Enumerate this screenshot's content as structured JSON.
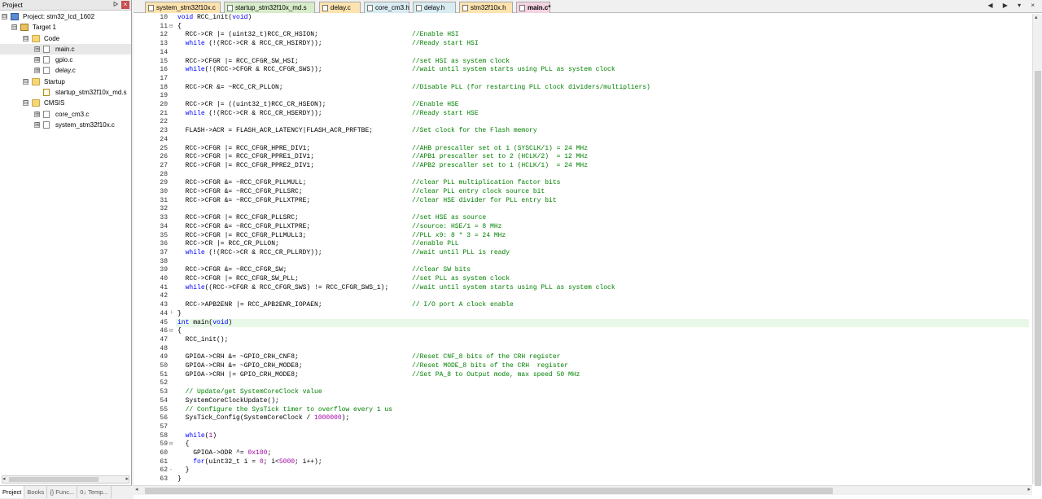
{
  "project_panel": {
    "title": "Project",
    "pin_label": "ᐅ",
    "close_label": "×",
    "tree": [
      {
        "label": "Project: stm32_lcd_1602",
        "icon": "project-icon",
        "expander": "⊟"
      },
      {
        "label": "Target 1",
        "icon": "target-icon",
        "expander": "⊟"
      },
      {
        "label": "Code",
        "icon": "folder-icon",
        "expander": "⊟"
      },
      {
        "label": "main.c",
        "icon": "c-file-icon",
        "expander": "⊞"
      },
      {
        "label": "gpio.c",
        "icon": "c-file-icon",
        "expander": "⊞"
      },
      {
        "label": "delay.c",
        "icon": "c-file-icon",
        "expander": "⊞"
      },
      {
        "label": "Startup",
        "icon": "folder-icon",
        "expander": "⊟"
      },
      {
        "label": "startup_stm32f10x_md.s",
        "icon": "asm-file-icon",
        "expander": ""
      },
      {
        "label": "CMSIS",
        "icon": "folder-icon",
        "expander": "⊟"
      },
      {
        "label": "core_cm3.c",
        "icon": "c-file-icon",
        "expander": "⊞"
      },
      {
        "label": "system_stm32f10x.c",
        "icon": "c-file-icon",
        "expander": "⊞"
      }
    ],
    "bottom_tabs": [
      "Project",
      "Books",
      "{} Func...",
      "0↓ Temp..."
    ]
  },
  "editor": {
    "tabs": [
      {
        "label": "system_stm32f10x.c",
        "kind": "c"
      },
      {
        "label": "startup_stm32f10x_md.s",
        "kind": "s"
      },
      {
        "label": "delay.c",
        "kind": "c"
      },
      {
        "label": "core_cm3.h",
        "kind": "h"
      },
      {
        "label": "delay.h",
        "kind": "h"
      },
      {
        "label": "stm32f10x.h",
        "kind": "c"
      },
      {
        "label": "main.c*",
        "kind": "active"
      }
    ],
    "tab_controls": "◀ ▶ ▾ ×",
    "current_line": 45,
    "lines": [
      {
        "n": 10,
        "fold": "",
        "code": "void RCC_init(void)",
        "comment": ""
      },
      {
        "n": 11,
        "fold": "⊟",
        "code": "{",
        "comment": ""
      },
      {
        "n": 12,
        "fold": "",
        "code": "  RCC->CR |= (uint32_t)RCC_CR_HSION;",
        "comment": "//Enable HSI"
      },
      {
        "n": 13,
        "fold": "",
        "code": "  while (!(RCC->CR & RCC_CR_HSIRDY));",
        "comment": "//Ready start HSI"
      },
      {
        "n": 14,
        "fold": "",
        "code": "",
        "comment": ""
      },
      {
        "n": 15,
        "fold": "",
        "code": "  RCC->CFGR |= RCC_CFGR_SW_HSI;",
        "comment": "//set HSI as system clock"
      },
      {
        "n": 16,
        "fold": "",
        "code": "  while(!(RCC->CFGR & RCC_CFGR_SWS));",
        "comment": "//wait until system starts using PLL as system clock"
      },
      {
        "n": 17,
        "fold": "",
        "code": "",
        "comment": ""
      },
      {
        "n": 18,
        "fold": "",
        "code": "  RCC->CR &= ~RCC_CR_PLLON;",
        "comment": "//Disable PLL (for restarting PLL clock dividers/multipliers)"
      },
      {
        "n": 19,
        "fold": "",
        "code": "",
        "comment": ""
      },
      {
        "n": 20,
        "fold": "",
        "code": "  RCC->CR |= ((uint32_t)RCC_CR_HSEON);",
        "comment": "//Enable HSE"
      },
      {
        "n": 21,
        "fold": "",
        "code": "  while (!(RCC->CR & RCC_CR_HSERDY));",
        "comment": "//Ready start HSE"
      },
      {
        "n": 22,
        "fold": "",
        "code": "",
        "comment": ""
      },
      {
        "n": 23,
        "fold": "",
        "code": "  FLASH->ACR = FLASH_ACR_LATENCY|FLASH_ACR_PRFTBE;",
        "comment": "//Set clock for the Flash memory"
      },
      {
        "n": 24,
        "fold": "",
        "code": "",
        "comment": ""
      },
      {
        "n": 25,
        "fold": "",
        "code": "  RCC->CFGR |= RCC_CFGR_HPRE_DIV1;",
        "comment": "//AHB prescaller set ot 1 (SYSCLK/1) = 24 MHz"
      },
      {
        "n": 26,
        "fold": "",
        "code": "  RCC->CFGR |= RCC_CFGR_PPRE1_DIV1;",
        "comment": "//APB1 prescaller set to 2 (HCLK/2)  = 12 MHz"
      },
      {
        "n": 27,
        "fold": "",
        "code": "  RCC->CFGR |= RCC_CFGR_PPRE2_DIV1;",
        "comment": "//APB2 prescaller set to 1 (HCLK/1)  = 24 MHz"
      },
      {
        "n": 28,
        "fold": "",
        "code": "",
        "comment": ""
      },
      {
        "n": 29,
        "fold": "",
        "code": "  RCC->CFGR &= ~RCC_CFGR_PLLMULL;",
        "comment": "//clear PLL multiplication factor bits"
      },
      {
        "n": 30,
        "fold": "",
        "code": "  RCC->CFGR &= ~RCC_CFGR_PLLSRC;",
        "comment": "//clear PLL entry clock source bit"
      },
      {
        "n": 31,
        "fold": "",
        "code": "  RCC->CFGR &= ~RCC_CFGR_PLLXTPRE;",
        "comment": "//clear HSE divider for PLL entry bit"
      },
      {
        "n": 32,
        "fold": "",
        "code": "",
        "comment": ""
      },
      {
        "n": 33,
        "fold": "",
        "code": "  RCC->CFGR |= RCC_CFGR_PLLSRC;",
        "comment": "//set HSE as source"
      },
      {
        "n": 34,
        "fold": "",
        "code": "  RCC->CFGR &= ~RCC_CFGR_PLLXTPRE;",
        "comment": "//source: HSE/1 = 8 MHz"
      },
      {
        "n": 35,
        "fold": "",
        "code": "  RCC->CFGR |= RCC_CFGR_PLLMULL3;",
        "comment": "//PLL x9: 8 * 3 = 24 MHz"
      },
      {
        "n": 36,
        "fold": "",
        "code": "  RCC->CR |= RCC_CR_PLLON;",
        "comment": "//enable PLL"
      },
      {
        "n": 37,
        "fold": "",
        "code": "  while (!(RCC->CR & RCC_CR_PLLRDY));",
        "comment": "//wait until PLL is ready"
      },
      {
        "n": 38,
        "fold": "",
        "code": "",
        "comment": ""
      },
      {
        "n": 39,
        "fold": "",
        "code": "  RCC->CFGR &= ~RCC_CFGR_SW;",
        "comment": "//clear SW bits"
      },
      {
        "n": 40,
        "fold": "",
        "code": "  RCC->CFGR |= RCC_CFGR_SW_PLL;",
        "comment": "//set PLL as system clock"
      },
      {
        "n": 41,
        "fold": "",
        "code": "  while((RCC->CFGR & RCC_CFGR_SWS) != RCC_CFGR_SWS_1);",
        "comment": "//wait until system starts using PLL as system clock"
      },
      {
        "n": 42,
        "fold": "",
        "code": "",
        "comment": ""
      },
      {
        "n": 43,
        "fold": "",
        "code": "  RCC->APB2ENR |= RCC_APB2ENR_IOPAEN;",
        "comment": "// I/O port A clock enable"
      },
      {
        "n": 44,
        "fold": "└",
        "code": "}",
        "comment": ""
      },
      {
        "n": 45,
        "fold": "",
        "code": "int main(void)",
        "comment": ""
      },
      {
        "n": 46,
        "fold": "⊟",
        "code": "{",
        "comment": ""
      },
      {
        "n": 47,
        "fold": "",
        "code": "  RCC_init();",
        "comment": ""
      },
      {
        "n": 48,
        "fold": "",
        "code": "",
        "comment": ""
      },
      {
        "n": 49,
        "fold": "",
        "code": "  GPIOA->CRH &= ~GPIO_CRH_CNF8;",
        "comment": "//Reset CNF_8 bits of the CRH register"
      },
      {
        "n": 50,
        "fold": "",
        "code": "  GPIOA->CRH &= ~GPIO_CRH_MODE8;",
        "comment": "//Reset MODE_8 bits of the CRH  register"
      },
      {
        "n": 51,
        "fold": "",
        "code": "  GPIOA->CRH |= GPIO_CRH_MODE8;",
        "comment": "//Set PA_8 to Output mode, max speed 50 MHz"
      },
      {
        "n": 52,
        "fold": "",
        "code": "",
        "comment": ""
      },
      {
        "n": 53,
        "fold": "",
        "code": "",
        "comment": "  // Update/get SystemCoreClock value"
      },
      {
        "n": 54,
        "fold": "",
        "code": "  SystemCoreClockUpdate();",
        "comment": ""
      },
      {
        "n": 55,
        "fold": "",
        "code": "",
        "comment": "  // Configure the SysTick timer to overflow every 1 us"
      },
      {
        "n": 56,
        "fold": "",
        "code": "  SysTick_Config(SystemCoreClock / 1000000);",
        "comment": ""
      },
      {
        "n": 57,
        "fold": "",
        "code": "",
        "comment": ""
      },
      {
        "n": 58,
        "fold": "",
        "code": "  while(1)",
        "comment": ""
      },
      {
        "n": 59,
        "fold": "⊟",
        "code": "  {",
        "comment": ""
      },
      {
        "n": 60,
        "fold": "",
        "code": "    GPIOA->ODR ^= 0x100;",
        "comment": ""
      },
      {
        "n": 61,
        "fold": "",
        "code": "    for(uint32_t i = 0; i<5000; i++);",
        "comment": ""
      },
      {
        "n": 62,
        "fold": "-",
        "code": "  }",
        "comment": ""
      },
      {
        "n": 63,
        "fold": "",
        "code": "}",
        "comment": ""
      }
    ]
  }
}
